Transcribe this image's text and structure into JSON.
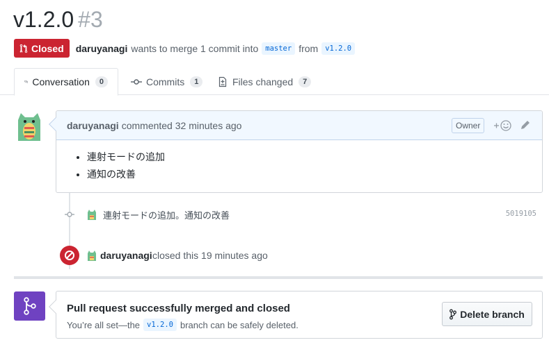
{
  "pr": {
    "title": "v1.2.0",
    "number": "#3",
    "state": "Closed",
    "author": "daruyanagi",
    "merge_text": "wants to merge 1 commit into",
    "base_branch": "master",
    "from_text": "from",
    "head_branch": "v1.2.0"
  },
  "tabs": [
    {
      "label": "Conversation",
      "count": "0",
      "icon": "comment-discussion-icon"
    },
    {
      "label": "Commits",
      "count": "1",
      "icon": "git-commit-icon"
    },
    {
      "label": "Files changed",
      "count": "7",
      "icon": "file-diff-icon"
    }
  ],
  "comment": {
    "author": "daruyanagi",
    "action": "commented 32 minutes ago",
    "owner_label": "Owner",
    "items": [
      "連射モードの追加",
      "通知の改善"
    ]
  },
  "commit": {
    "message": "連射モードの追加。通知の改善",
    "sha": "5019105"
  },
  "closed_event": {
    "author": "daruyanagi",
    "text": "closed this 19 minutes ago"
  },
  "merge": {
    "title": "Pull request successfully merged and closed",
    "sub_prefix": "You’re all set—the",
    "branch": "v1.2.0",
    "sub_suffix": "branch can be safely deleted.",
    "delete_label": "Delete branch"
  },
  "colors": {
    "closed_red": "#cb2431",
    "merged_purple": "#6f42c1",
    "link_blue": "#0366d6",
    "avatar_green": "#6fbf8f"
  }
}
